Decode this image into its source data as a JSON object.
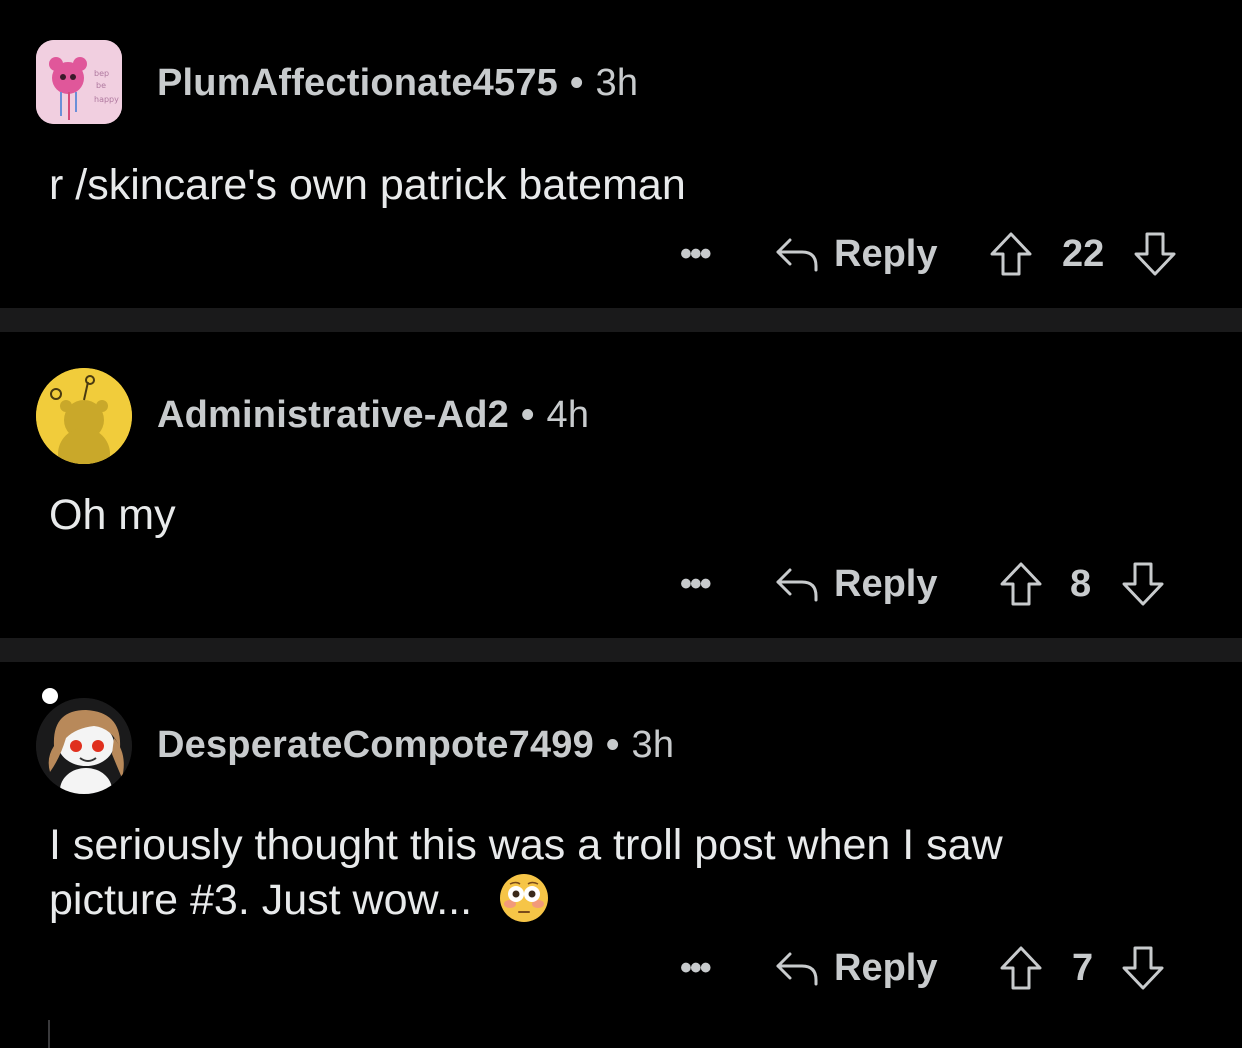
{
  "comments": [
    {
      "username": "PlumAffectionate4575",
      "separator": "•",
      "time": "3h",
      "text": "r /skincare's own patrick bateman",
      "more": "•••",
      "reply": "Reply",
      "votes": "22",
      "avatar": "pink-bear-drawing-avatar"
    },
    {
      "username": "Administrative-Ad2",
      "separator": "•",
      "time": "4h",
      "text": "Oh my",
      "more": "•••",
      "reply": "Reply",
      "votes": "8",
      "avatar": "default-snoo-yellow-avatar"
    },
    {
      "username": "DesperateCompote7499",
      "separator": "•",
      "time": "3h",
      "text_line1": "I seriously thought this was a troll post when I saw",
      "text_line2": "picture #3. Just wow...",
      "emoji": "flushed-face-emoji",
      "more": "•••",
      "reply": "Reply",
      "votes": "7",
      "avatar": "snoo-brown-hair-avatar"
    }
  ],
  "colors": {
    "background": "#000000",
    "divider": "#1a1a1b",
    "meta_text": "#c8cbcd",
    "body_text": "#e8eaeb"
  }
}
